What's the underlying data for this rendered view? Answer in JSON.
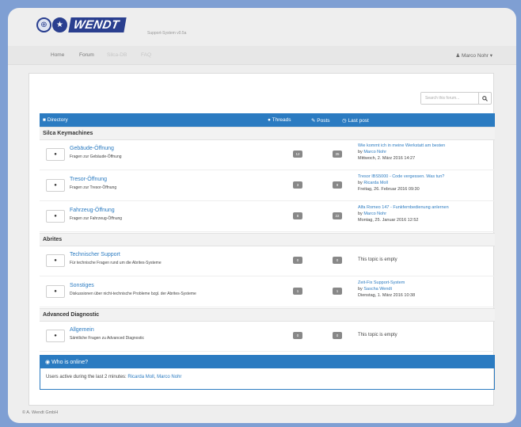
{
  "brand": {
    "name": "WENDT",
    "tagline": "Support-System v0.5a",
    "colors": {
      "logo": "#2a3f8f",
      "accent": "#2b7bc1",
      "badge": "#888888",
      "background": "#7f9fd3"
    }
  },
  "nav": {
    "home": "Home",
    "forum": "Forum",
    "item3": "Silca-DB",
    "faq": "FAQ",
    "user": "Marco Nohr",
    "user_icon": "person-icon"
  },
  "search": {
    "placeholder": "Search this forum...",
    "icon": "search-icon"
  },
  "directory": {
    "title": "Directory",
    "threads_label": "Threads",
    "posts_label": "Posts",
    "last_post_label": "Last post"
  },
  "categories": [
    {
      "name": "Silca Keymachines",
      "forums": [
        {
          "title": "Gebäude-Öffnung",
          "description": "Fragen zur Gebäude-Öffnung",
          "threads": "12",
          "posts": "35",
          "last_post": {
            "title": "Wie kommt ich in meine Werkstatt am besten",
            "by": "by",
            "user": "Marco Nohr",
            "date": "Mittwoch, 2. März 2016 14:27"
          }
        },
        {
          "title": "Tresor-Öffnung",
          "description": "Fragen zur Tresor-Öffnung",
          "threads": "3",
          "posts": "9",
          "last_post": {
            "title": "Tresor IBS5000 - Code vergessen. Was tun?",
            "by": "by",
            "user": "Ricarda Moll",
            "date": "Freitag, 26. Februar 2016 09:30"
          }
        },
        {
          "title": "Fahrzeug-Öffnung",
          "description": "Fragen zur Fahrzeug-Öffnung",
          "threads": "8",
          "posts": "22",
          "last_post": {
            "title": "Alfa Romeo 147 - Funkfernbedienung anlernen",
            "by": "by",
            "user": "Marco Nohr",
            "date": "Montag, 25. Januar 2016 12:52"
          }
        }
      ]
    },
    {
      "name": "Abrites",
      "forums": [
        {
          "title": "Technischer Support",
          "description": "Für technische Fragen rund um die Abrites-Systeme",
          "threads": "0",
          "posts": "0",
          "empty_text": "This topic is empty"
        },
        {
          "title": "Sonstiges",
          "description": "Diskussionen über nicht-technische Probleme bzgl. der Abrites-Systeme",
          "threads": "1",
          "posts": "1",
          "last_post": {
            "title": "Zeit-Fix Support-System",
            "by": "by",
            "user": "Sascha Wendt",
            "date": "Dienstag, 1. März 2016 10:38"
          }
        }
      ]
    },
    {
      "name": "Advanced Diagnostic",
      "forums": [
        {
          "title": "Allgemein",
          "description": "Sämtliche Fragen zu Advanced Diagnostic",
          "threads": "0",
          "posts": "0",
          "empty_text": "This topic is empty"
        }
      ]
    }
  ],
  "who_online": {
    "title": "Who is online?",
    "text": "Users active during the last 2 minutes:",
    "users": [
      "Ricarda Moll",
      "Marco Nohr"
    ]
  },
  "footer": "© A. Wendt GmbH"
}
